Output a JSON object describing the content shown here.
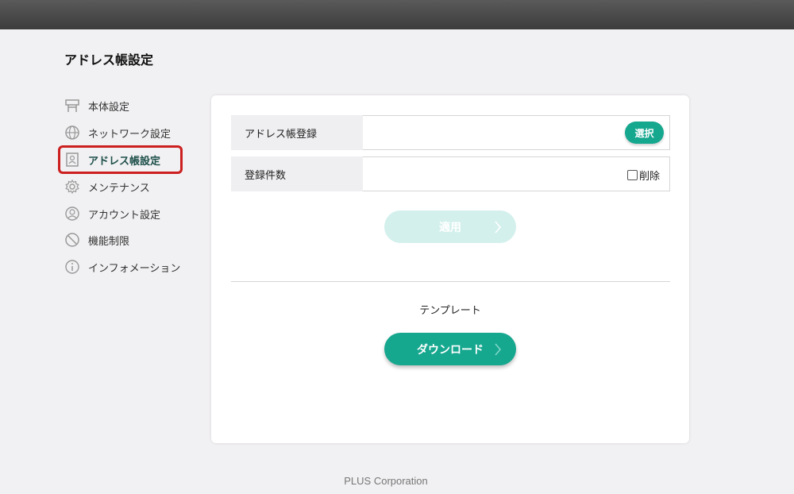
{
  "page": {
    "title": "アドレス帳設定"
  },
  "sidebar": {
    "items": [
      {
        "label": "本体設定",
        "icon": "printer-icon"
      },
      {
        "label": "ネットワーク設定",
        "icon": "globe-icon"
      },
      {
        "label": "アドレス帳設定",
        "icon": "address-book-icon",
        "active": true
      },
      {
        "label": "メンテナンス",
        "icon": "gear-icon"
      },
      {
        "label": "アカウント設定",
        "icon": "user-icon"
      },
      {
        "label": "機能制限",
        "icon": "prohibited-icon"
      },
      {
        "label": "インフォメーション",
        "icon": "info-icon"
      }
    ]
  },
  "form": {
    "register_label": "アドレス帳登録",
    "register_value": "",
    "select_button": "選択",
    "count_label": "登録件数",
    "count_value": "",
    "delete_label": "削除",
    "delete_checked": false,
    "apply_button": "適用"
  },
  "template": {
    "label": "テンプレート",
    "download_button": "ダウンロード"
  },
  "footer": {
    "text": "PLUS Corporation"
  },
  "colors": {
    "accent": "#16a78f",
    "accent_disabled": "#d3f0ec",
    "highlight_frame": "#cc1f1f",
    "topbar": "#474747"
  }
}
